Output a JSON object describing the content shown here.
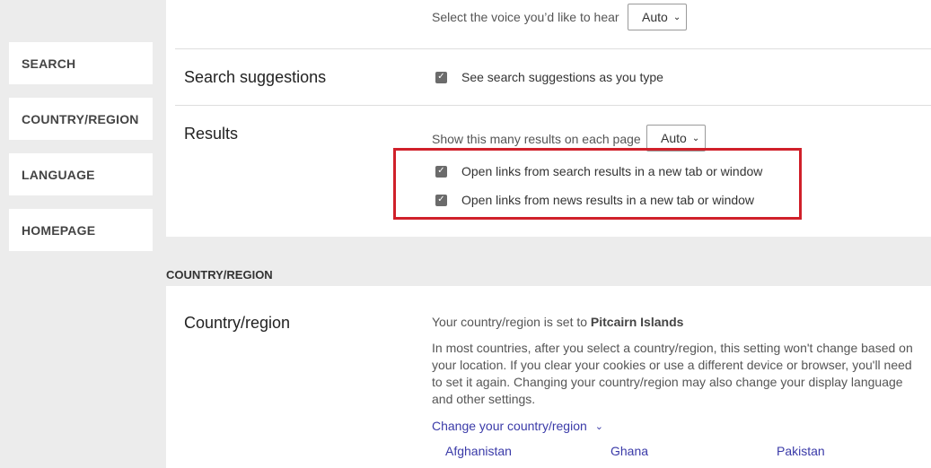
{
  "sidebar": {
    "items": [
      {
        "label": "SEARCH"
      },
      {
        "label": "COUNTRY/REGION"
      },
      {
        "label": "LANGUAGE"
      },
      {
        "label": "HOMEPAGE"
      }
    ]
  },
  "voice": {
    "label": "Select the voice you’d like to hear",
    "selected": "Auto"
  },
  "search_suggestions": {
    "title": "Search suggestions",
    "checkbox_label": "See search suggestions as you type",
    "checked": true
  },
  "results": {
    "title": "Results",
    "count_label": "Show this many results on each page",
    "count_selected": "Auto",
    "open_search_label": "Open links from search results in a new tab or window",
    "open_news_label": "Open links from news results in a new tab or window",
    "open_search_checked": true,
    "open_news_checked": true
  },
  "country_section": {
    "heading": "COUNTRY/REGION",
    "title": "Country/region",
    "current_prefix": "Your country/region is set to ",
    "current_value": "Pitcairn Islands",
    "description": "In most countries, after you select a country/region, this setting won't change based on your location. If you clear your cookies or use a different device or browser, you'll need to set it again. Changing your country/region may also change your display language and other settings.",
    "change_link": "Change your country/region",
    "options": [
      "Afghanistan",
      "Ghana",
      "Pakistan"
    ]
  },
  "colors": {
    "highlight": "#d0202a",
    "link": "#3a3aa8",
    "background": "#ececec"
  }
}
